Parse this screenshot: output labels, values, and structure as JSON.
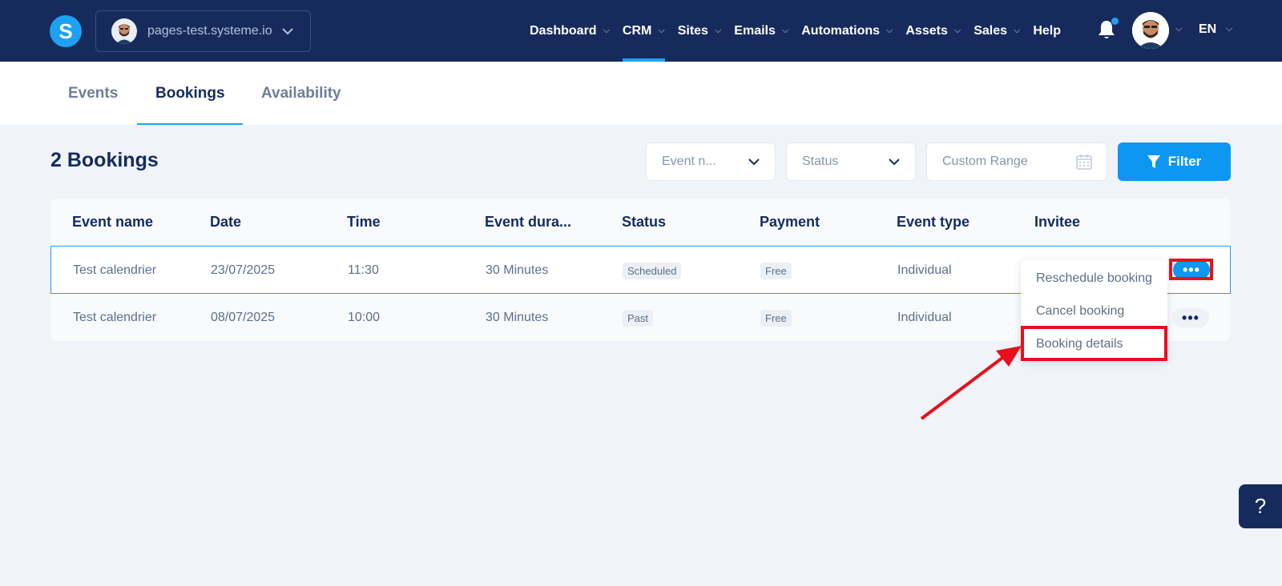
{
  "app": {
    "logo_letter": "S",
    "site_name": "pages-test.systeme.io"
  },
  "nav": {
    "items": [
      {
        "label": "Dashboard",
        "has_menu": true
      },
      {
        "label": "CRM",
        "has_menu": true,
        "active": true
      },
      {
        "label": "Sites",
        "has_menu": true
      },
      {
        "label": "Emails",
        "has_menu": true
      },
      {
        "label": "Automations",
        "has_menu": true
      },
      {
        "label": "Assets",
        "has_menu": true
      },
      {
        "label": "Sales",
        "has_menu": true
      },
      {
        "label": "Help",
        "has_menu": false
      }
    ],
    "language": "EN"
  },
  "subtabs": [
    {
      "label": "Events",
      "active": false
    },
    {
      "label": "Bookings",
      "active": true
    },
    {
      "label": "Availability",
      "active": false
    }
  ],
  "page": {
    "title": "2 Bookings"
  },
  "filters": {
    "event_name_placeholder": "Event n...",
    "status_placeholder": "Status",
    "range_placeholder": "Custom Range",
    "filter_label": "Filter"
  },
  "table": {
    "headers": [
      "Event name",
      "Date",
      "Time",
      "Event dura...",
      "Status",
      "Payment",
      "Event type",
      "Invitee"
    ],
    "rows": [
      {
        "event_name": "Test calendrier",
        "date": "23/07/2025",
        "time": "11:30",
        "duration": "30 Minutes",
        "status": "Scheduled",
        "payment": "Free",
        "event_type": "Individual",
        "invitee": ""
      },
      {
        "event_name": "Test calendrier",
        "date": "08/07/2025",
        "time": "10:00",
        "duration": "30 Minutes",
        "status": "Past",
        "payment": "Free",
        "event_type": "Individual",
        "invitee": ""
      }
    ]
  },
  "row_menu": {
    "items": [
      "Reschedule booking",
      "Cancel booking",
      "Booking details"
    ]
  },
  "help_button": "?",
  "colors": {
    "nav_bg": "#162b5c",
    "accent": "#1da1f2",
    "primary_button": "#0d96f2",
    "annotation": "#e8101c"
  }
}
